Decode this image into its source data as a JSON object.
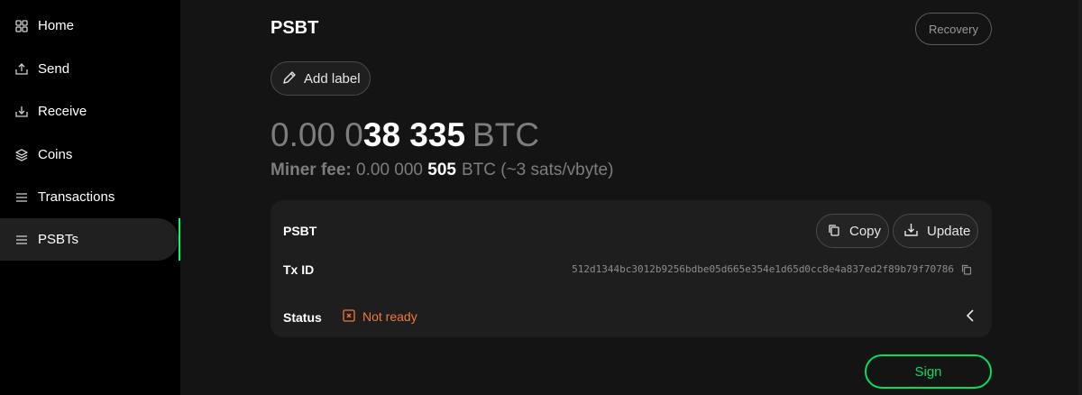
{
  "sidebar": {
    "items": [
      {
        "label": "Home",
        "icon": "home-grid-icon"
      },
      {
        "label": "Send",
        "icon": "send-icon"
      },
      {
        "label": "Receive",
        "icon": "receive-icon"
      },
      {
        "label": "Coins",
        "icon": "coins-stack-icon"
      },
      {
        "label": "Transactions",
        "icon": "list-icon"
      },
      {
        "label": "PSBTs",
        "icon": "list-icon"
      }
    ],
    "active": "PSBTs"
  },
  "header": {
    "title": "PSBT",
    "recovery_label": "Recovery"
  },
  "add_label": {
    "label": "Add label",
    "icon": "pencil-icon"
  },
  "amount": {
    "dim_part": "0.00 0",
    "bold_part": "38 335",
    "unit": "BTC"
  },
  "fee": {
    "label": "Miner fee:",
    "dim_part": "0.00 000",
    "bold_part": "505",
    "unit": "BTC (~3 sats/vbyte)"
  },
  "card": {
    "psbt_label": "PSBT",
    "copy_label": "Copy",
    "update_label": "Update",
    "txid_label": "Tx ID",
    "txid_value": "512d1344bc3012b9256bdbe05d665e354e1d65d0cc8e4a837ed2f89b79f70786",
    "status_label": "Status",
    "status_value": "Not ready"
  },
  "sign_label": "Sign",
  "colors": {
    "accent": "#00e060",
    "warning": "#f0783c",
    "background": "#141414",
    "sidebar": "#000000"
  }
}
